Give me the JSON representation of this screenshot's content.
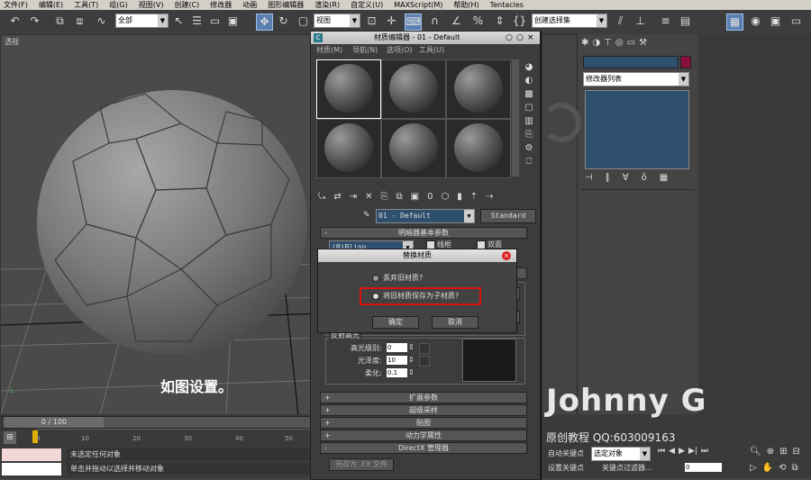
{
  "menubar": [
    "文件(F)",
    "编辑(E)",
    "工具(T)",
    "组(G)",
    "视图(V)",
    "创建(C)",
    "修改器",
    "动画",
    "图形编辑器",
    "渲染(R)",
    "自定义(U)",
    "MAXScript(M)",
    "帮助(H)",
    "Tentacles"
  ],
  "toolbar": {
    "filter_value": "全部",
    "view_value": "视图",
    "selection_set_value": "创建选择集"
  },
  "viewport": {
    "label": "透视",
    "caption": "如图设置。"
  },
  "trackbar": {
    "frame_display": "0 / 100",
    "ticks": [
      "0",
      "10",
      "20",
      "30",
      "40",
      "50"
    ]
  },
  "status": {
    "line1": "未选定任何对象",
    "line2": "单击并拖动以选择并移动对象"
  },
  "cmdpanel": {
    "modifier_list": "修改器列表"
  },
  "mateditor": {
    "title": "材质编辑器 - 01 - Default",
    "menu": [
      "材质(M)",
      "导航(N)",
      "选项(O)",
      "工具(U)"
    ],
    "material_name": "01 - Default",
    "material_type": "Standard",
    "rollout_shader": "明暗器基本参数",
    "shader_value": "(B)Blinn",
    "wire_label": "线框",
    "twosided_label": "双面",
    "specular_title": "反射高光",
    "spec_level_label": "高光级别:",
    "spec_level_value": "0",
    "gloss_label": "光泽度:",
    "gloss_value": "10",
    "soften_label": "柔化:",
    "soften_value": "0.1",
    "rollouts": [
      "扩展参数",
      "超级采样",
      "贴图",
      "动力学属性",
      "DirectX 管理器"
    ],
    "save_fx_button": "另存为 .FX 文件"
  },
  "dialog": {
    "title": "替换材质",
    "option1": "丢弃旧材质?",
    "option2": "将旧材质保存为子材质?",
    "ok": "确定",
    "cancel": "取消"
  },
  "bottom_right": {
    "auto_key": "自动关键点",
    "selected_object": "选定对象",
    "set_key": "设置关键点",
    "key_filters": "关键点过滤器...",
    "frame_value": "0"
  },
  "watermark": {
    "name": "Johnny G",
    "sub": "原创教程   QQ:603009163"
  },
  "colors": {
    "highlight_red": "#e01010",
    "selected_blue": "#5a7fb0",
    "panel_field": "#2e4f6e"
  }
}
